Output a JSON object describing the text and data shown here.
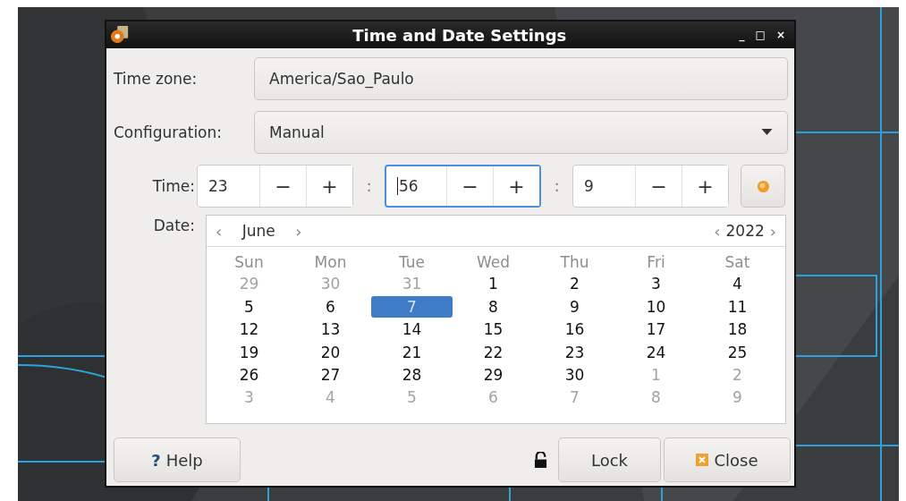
{
  "window": {
    "title": "Time and Date Settings",
    "controls": [
      "_",
      "□",
      "×"
    ]
  },
  "time_zone": {
    "label": "Time zone:",
    "value": "America/Sao_Paulo"
  },
  "configuration": {
    "label": "Configuration:",
    "value": "Manual"
  },
  "time": {
    "label": "Time:",
    "separator": ":",
    "fields": [
      {
        "value": "23",
        "focused": false,
        "minus": "−",
        "plus": "+"
      },
      {
        "value": "56",
        "focused": true,
        "minus": "−",
        "plus": "+"
      },
      {
        "value": "9",
        "focused": false,
        "minus": "−",
        "plus": "+"
      }
    ]
  },
  "date": {
    "label": "Date:",
    "prev": "‹",
    "next": "›",
    "month": "June",
    "year": "2022",
    "weekdays": [
      "Sun",
      "Mon",
      "Tue",
      "Wed",
      "Thu",
      "Fri",
      "Sat"
    ],
    "weeks": [
      [
        {
          "day": "29",
          "other_month": true,
          "selected": false
        },
        {
          "day": "30",
          "other_month": true,
          "selected": false
        },
        {
          "day": "31",
          "other_month": true,
          "selected": false
        },
        {
          "day": "1",
          "other_month": false,
          "selected": false
        },
        {
          "day": "2",
          "other_month": false,
          "selected": false
        },
        {
          "day": "3",
          "other_month": false,
          "selected": false
        },
        {
          "day": "4",
          "other_month": false,
          "selected": false
        }
      ],
      [
        {
          "day": "5",
          "other_month": false,
          "selected": false
        },
        {
          "day": "6",
          "other_month": false,
          "selected": false
        },
        {
          "day": "7",
          "other_month": false,
          "selected": true
        },
        {
          "day": "8",
          "other_month": false,
          "selected": false
        },
        {
          "day": "9",
          "other_month": false,
          "selected": false
        },
        {
          "day": "10",
          "other_month": false,
          "selected": false
        },
        {
          "day": "11",
          "other_month": false,
          "selected": false
        }
      ],
      [
        {
          "day": "12",
          "other_month": false,
          "selected": false
        },
        {
          "day": "13",
          "other_month": false,
          "selected": false
        },
        {
          "day": "14",
          "other_month": false,
          "selected": false
        },
        {
          "day": "15",
          "other_month": false,
          "selected": false
        },
        {
          "day": "16",
          "other_month": false,
          "selected": false
        },
        {
          "day": "17",
          "other_month": false,
          "selected": false
        },
        {
          "day": "18",
          "other_month": false,
          "selected": false
        }
      ],
      [
        {
          "day": "19",
          "other_month": false,
          "selected": false
        },
        {
          "day": "20",
          "other_month": false,
          "selected": false
        },
        {
          "day": "21",
          "other_month": false,
          "selected": false
        },
        {
          "day": "22",
          "other_month": false,
          "selected": false
        },
        {
          "day": "23",
          "other_month": false,
          "selected": false
        },
        {
          "day": "24",
          "other_month": false,
          "selected": false
        },
        {
          "day": "25",
          "other_month": false,
          "selected": false
        }
      ],
      [
        {
          "day": "26",
          "other_month": false,
          "selected": false
        },
        {
          "day": "27",
          "other_month": false,
          "selected": false
        },
        {
          "day": "28",
          "other_month": false,
          "selected": false
        },
        {
          "day": "29",
          "other_month": false,
          "selected": false
        },
        {
          "day": "30",
          "other_month": false,
          "selected": false
        },
        {
          "day": "1",
          "other_month": true,
          "selected": false
        },
        {
          "day": "2",
          "other_month": true,
          "selected": false
        }
      ],
      [
        {
          "day": "3",
          "other_month": true,
          "selected": false
        },
        {
          "day": "4",
          "other_month": true,
          "selected": false
        },
        {
          "day": "5",
          "other_month": true,
          "selected": false
        },
        {
          "day": "6",
          "other_month": true,
          "selected": false
        },
        {
          "day": "7",
          "other_month": true,
          "selected": false
        },
        {
          "day": "8",
          "other_month": true,
          "selected": false
        },
        {
          "day": "9",
          "other_month": true,
          "selected": false
        }
      ]
    ]
  },
  "buttons": {
    "help": {
      "mark": "?",
      "label": "Help"
    },
    "lock": "Lock",
    "close": "Close"
  }
}
